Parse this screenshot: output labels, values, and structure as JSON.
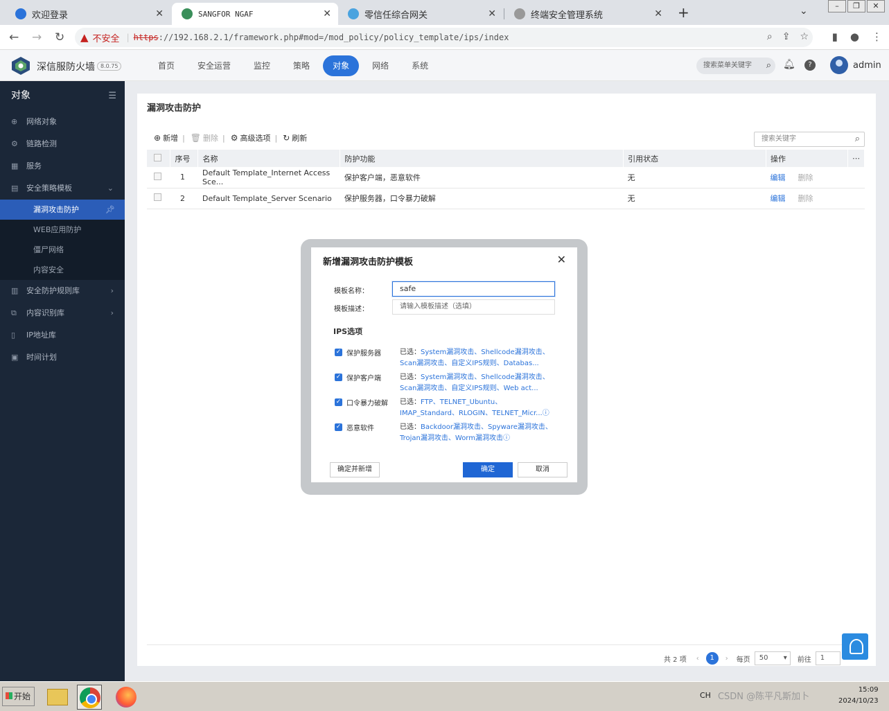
{
  "browser": {
    "tabs": [
      {
        "label": "欢迎登录",
        "active": false
      },
      {
        "label": "SANGFOR NGAF",
        "active": true
      },
      {
        "label": "零信任综合网关",
        "active": false
      },
      {
        "label": "终端安全管理系统",
        "active": false
      }
    ],
    "new_tab": "+",
    "security_warning": "不安全",
    "url_scheme": "https",
    "url_rest": "://192.168.2.1/framework.php#mod=/mod_policy/policy_template/ips/index"
  },
  "app": {
    "brand": "深信服防火墙",
    "version": "8.0.75",
    "nav": [
      {
        "label": "首页",
        "active": false
      },
      {
        "label": "安全运营",
        "active": false
      },
      {
        "label": "监控",
        "active": false
      },
      {
        "label": "策略",
        "active": false
      },
      {
        "label": "对象",
        "active": true
      },
      {
        "label": "网络",
        "active": false
      },
      {
        "label": "系统",
        "active": false
      }
    ],
    "search_placeholder": "搜索菜单关键字",
    "username": "admin",
    "help_glyph": "?"
  },
  "sidebar": {
    "title": "对象",
    "items": [
      {
        "label": "网络对象",
        "icon": "network-object-icon",
        "glyph": "⊕",
        "arrow": ""
      },
      {
        "label": "链路检测",
        "icon": "link-check-icon",
        "glyph": "⚙",
        "arrow": ""
      },
      {
        "label": "服务",
        "icon": "service-icon",
        "glyph": "▦",
        "arrow": ""
      },
      {
        "label": "安全策略模板",
        "icon": "policy-template-icon",
        "glyph": "▤",
        "arrow": "⌄"
      }
    ],
    "subitems": [
      {
        "label": "漏洞攻击防护",
        "active": true
      },
      {
        "label": "WEB应用防护",
        "active": false
      },
      {
        "label": "僵尸网络",
        "active": false
      },
      {
        "label": "内容安全",
        "active": false
      }
    ],
    "items_after": [
      {
        "label": "安全防护规则库",
        "icon": "rule-library-icon",
        "glyph": "▥",
        "arrow": "›"
      },
      {
        "label": "内容识别库",
        "icon": "content-library-icon",
        "glyph": "⧉",
        "arrow": "›"
      },
      {
        "label": "IP地址库",
        "icon": "ip-library-icon",
        "glyph": "▯",
        "arrow": ""
      },
      {
        "label": "时间计划",
        "icon": "schedule-icon",
        "glyph": "▣",
        "arrow": ""
      }
    ]
  },
  "page": {
    "title": "漏洞攻击防护",
    "toolbar": {
      "add": "新增",
      "delete": "删除",
      "advanced": "高级选项",
      "refresh": "刷新"
    },
    "search_placeholder": "搜索关键字",
    "table": {
      "headers": [
        "序号",
        "名称",
        "防护功能",
        "引用状态",
        "操作"
      ],
      "rows": [
        {
          "no": "1",
          "name": "Default Template_Internet Access Sce...",
          "function": "保护客户端，恶意软件",
          "status": "无",
          "edit": "编辑",
          "delete": "删除"
        },
        {
          "no": "2",
          "name": "Default Template_Server Scenario",
          "function": "保护服务器，口令暴力破解",
          "status": "无",
          "edit": "编辑",
          "delete": "删除"
        }
      ]
    },
    "pager": {
      "total": "共 2 项",
      "current_page": "1",
      "per_page_label": "每页",
      "per_page": "50",
      "goto_label": "前往",
      "goto_value": "1"
    }
  },
  "modal": {
    "title": "新增漏洞攻击防护模板",
    "name_label": "模板名称：",
    "name_value": "safe",
    "desc_label": "模板描述：",
    "desc_placeholder": "请输入模板描述（选填）",
    "section": "IPS选项",
    "options": [
      {
        "name": "保护服务器",
        "checked": true,
        "prefix": "已选：",
        "desc": "System漏洞攻击、Shellcode漏洞攻击、Scan漏洞攻击、自定义IPS规则、Databas..."
      },
      {
        "name": "保护客户端",
        "checked": true,
        "prefix": "已选：",
        "desc": "System漏洞攻击、Shellcode漏洞攻击、Scan漏洞攻击、自定义IPS规则、Web act..."
      },
      {
        "name": "口令暴力破解",
        "checked": true,
        "prefix": "已选：",
        "desc": "FTP、TELNET_Ubuntu、IMAP_Standard、RLOGIN、TELNET_Micr...ⓘ"
      },
      {
        "name": "恶意软件",
        "checked": true,
        "prefix": "已选：",
        "desc": "Backdoor漏洞攻击、Spyware漏洞攻击、Trojan漏洞攻击、Worm漏洞攻击ⓘ"
      }
    ],
    "btn_confirm_add": "确定并新增",
    "btn_ok": "确定",
    "btn_cancel": "取消"
  },
  "taskbar": {
    "start": "开始",
    "ime": "CH",
    "watermark": "CSDN @陈平凡斯加卜",
    "time": "15:09",
    "date": "2024/10/23"
  }
}
